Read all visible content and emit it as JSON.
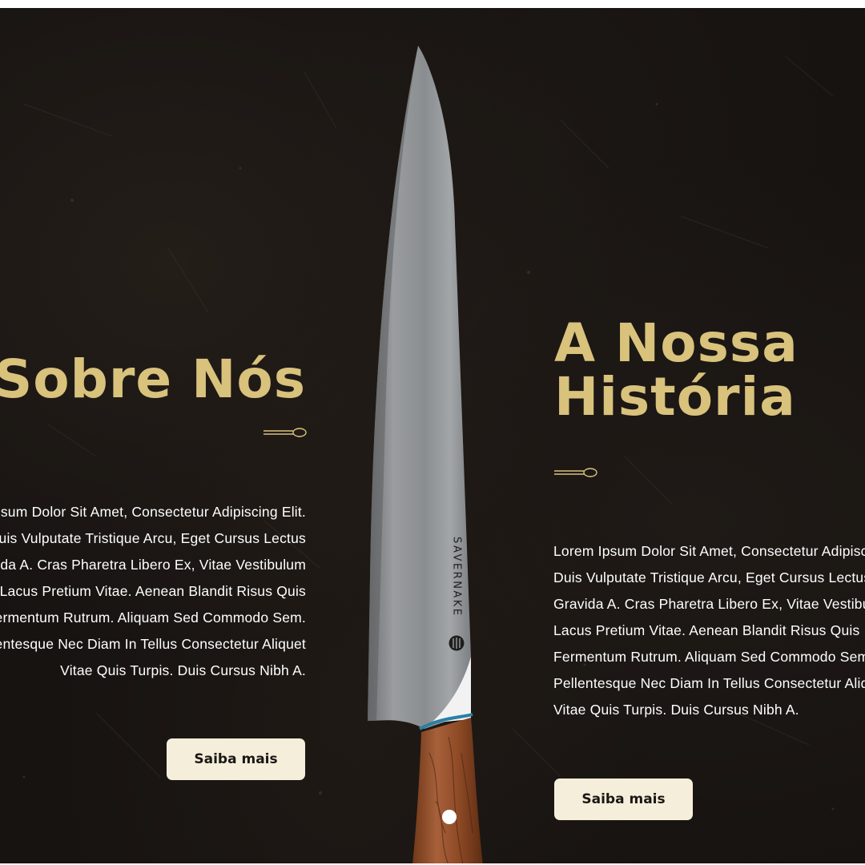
{
  "left_section": {
    "heading": "Sobre Nós",
    "paragraph_lines": [
      "Lorem Ipsum Dolor Sit Amet, Consectetur Adipiscing Elit.",
      "Duis Vulputate Tristique Arcu, Eget Cursus Lectus",
      "Gravida A. Cras Pharetra Libero Ex, Vitae Vestibulum",
      "Lacus Pretium Vitae. Aenean Blandit Risus Quis",
      "Fermentum Rutrum. Aliquam Sed Commodo Sem.",
      "Pellentesque Nec Diam In Tellus Consectetur Aliquet",
      "Vitae Quis Turpis. Duis Cursus Nibh A."
    ],
    "button_label": "Saiba mais"
  },
  "right_section": {
    "heading": "A Nossa História",
    "paragraph_lines": [
      "Lorem Ipsum Dolor Sit Amet, Consectetur Adipiscing Elit.",
      "Duis Vulputate Tristique Arcu, Eget Cursus Lectus",
      "Gravida A. Cras Pharetra Libero Ex, Vitae Vestibulum",
      "Lacus Pretium Vitae. Aenean Blandit Risus Quis",
      "Fermentum Rutrum. Aliquam Sed Commodo Sem.",
      "Pellentesque Nec Diam In Tellus Consectetur Aliquet",
      "Vitae Quis Turpis. Duis Cursus Nibh A."
    ],
    "button_label": "Saiba mais"
  },
  "knife": {
    "brand_text": "SAVERNAKE"
  },
  "icons": {
    "divider": "whisk-icon",
    "brand_logo": "savernake-logo-icon"
  },
  "colors": {
    "background": "#171311",
    "heading_accent": "#d8c27c",
    "button_background": "#f5eedb",
    "button_text": "#1b1713",
    "body_text": "#ffffff"
  }
}
